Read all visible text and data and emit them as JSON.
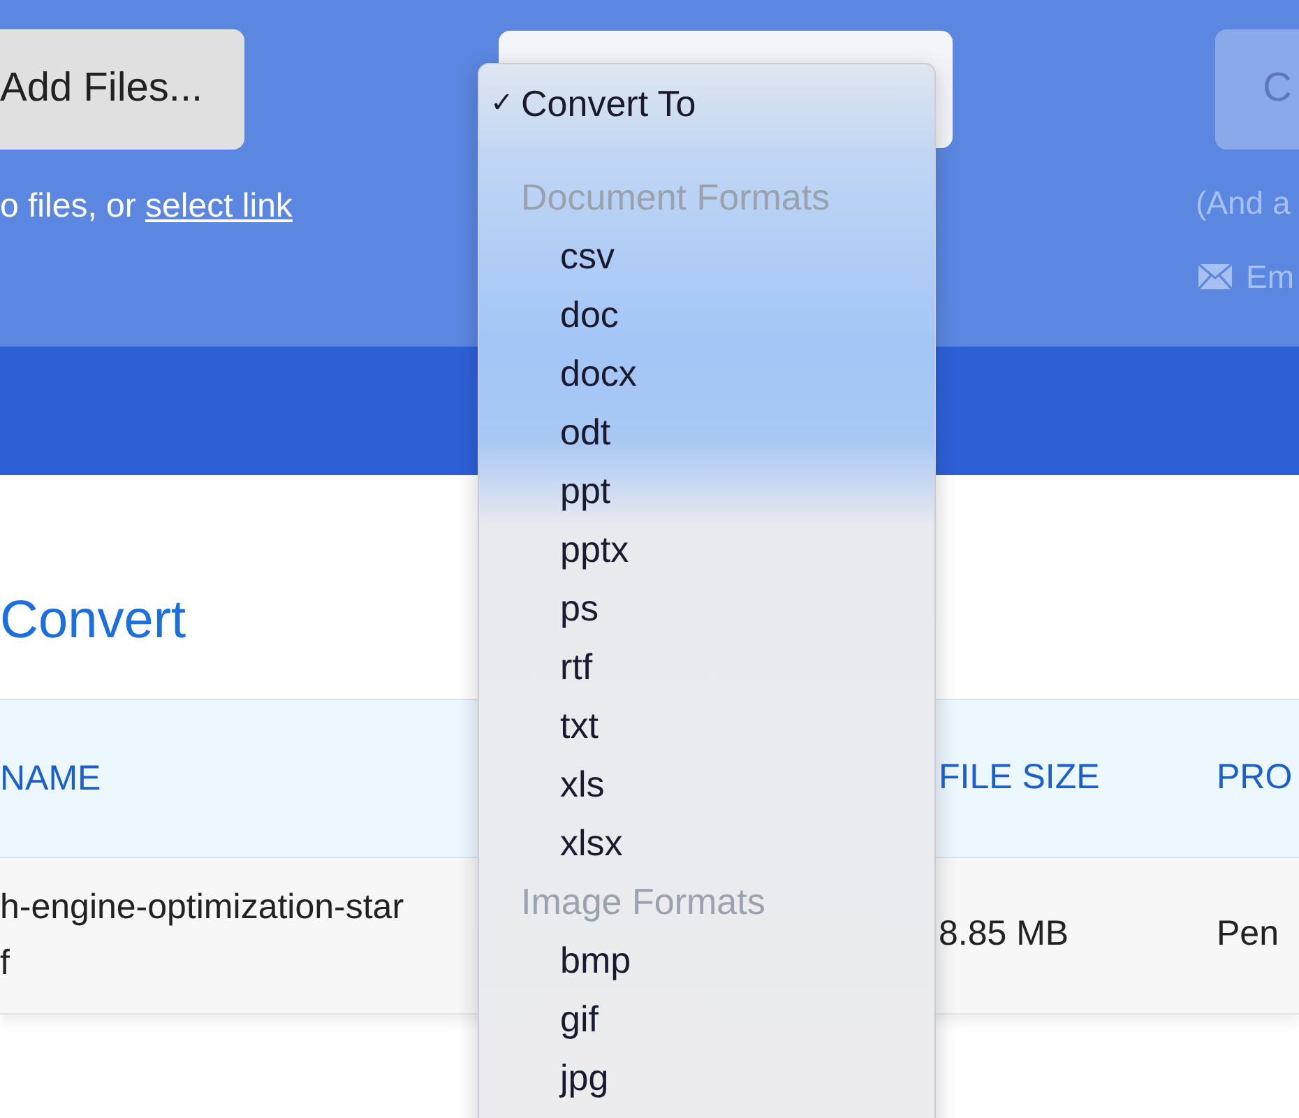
{
  "header": {
    "add_button": "Add Files...",
    "drop_hint": "o files, or",
    "select_link": "select link",
    "convert_button": "C",
    "note": "(And a",
    "email_label": "Em"
  },
  "format_menu": {
    "check_mark": "✓",
    "options": [
      {
        "kind": "option",
        "label": "Convert To",
        "selected": true
      },
      {
        "kind": "group",
        "label": "Document Formats"
      },
      {
        "kind": "option",
        "label": "csv",
        "selected": false
      },
      {
        "kind": "option",
        "label": "doc",
        "selected": false
      },
      {
        "kind": "option",
        "label": "docx",
        "selected": false
      },
      {
        "kind": "option",
        "label": "odt",
        "selected": false
      },
      {
        "kind": "option",
        "label": "ppt",
        "selected": false
      },
      {
        "kind": "option",
        "label": "pptx",
        "selected": false
      },
      {
        "kind": "option",
        "label": "ps",
        "selected": false
      },
      {
        "kind": "option",
        "label": "rtf",
        "selected": false
      },
      {
        "kind": "option",
        "label": "txt",
        "selected": false
      },
      {
        "kind": "option",
        "label": "xls",
        "selected": false
      },
      {
        "kind": "option",
        "label": "xlsx",
        "selected": false
      },
      {
        "kind": "group",
        "label": "Image Formats"
      },
      {
        "kind": "option",
        "label": "bmp",
        "selected": false
      },
      {
        "kind": "option",
        "label": "gif",
        "selected": false
      },
      {
        "kind": "option",
        "label": "jpg",
        "selected": false
      }
    ]
  },
  "section_title": "Convert",
  "table": {
    "columns": [
      "NAME",
      "FILE SIZE",
      "PRO"
    ],
    "rows": [
      {
        "name_lines": [
          "h-engine-optimization-star",
          "f"
        ],
        "file_size": "8.85 MB",
        "status": "Pen"
      }
    ]
  }
}
